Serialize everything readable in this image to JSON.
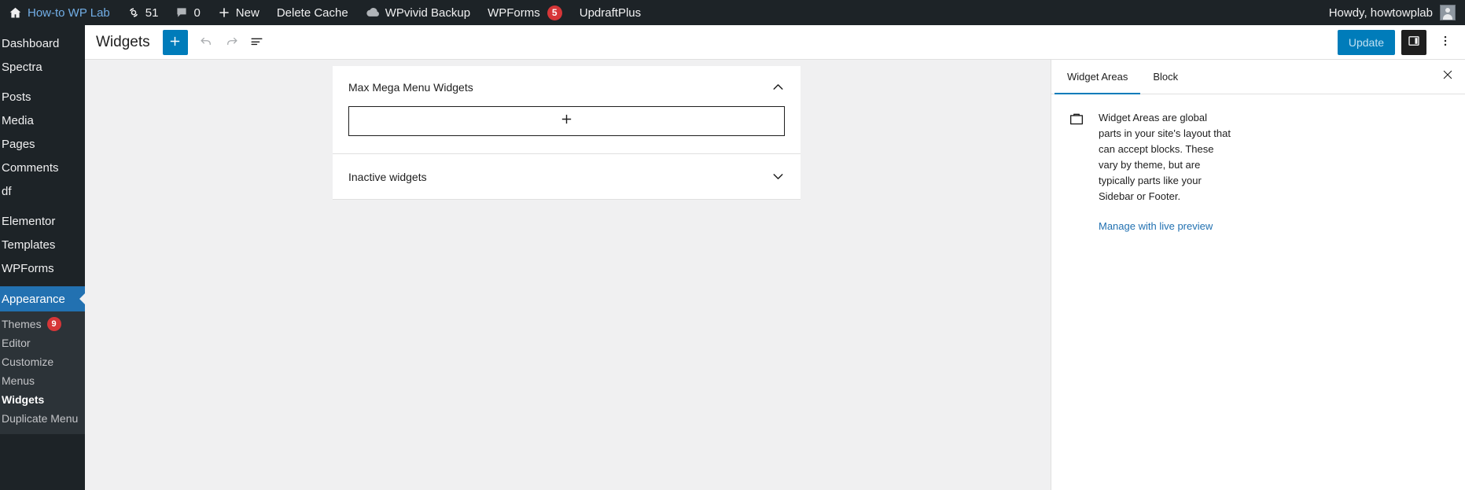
{
  "adminbar": {
    "site_name": "How-to WP Lab",
    "site_icon": "home-icon",
    "updates_icon": "updates-icon",
    "updates_count": "51",
    "comments_icon": "comment-bubble-icon",
    "comments_count": "0",
    "new_icon": "plus-icon",
    "new_label": "New",
    "delete_cache_label": "Delete Cache",
    "wpvivid_icon": "cloud-icon",
    "wpvivid_label": "WPvivid Backup",
    "wpforms_label": "WPForms",
    "wpforms_badge": "5",
    "updraftplus_label": "UpdraftPlus",
    "howdy_label": "Howdy, howtowplab",
    "avatar": "user-avatar"
  },
  "sidebar": {
    "items": [
      {
        "label": "Dashboard",
        "current": false
      },
      {
        "label": "Spectra",
        "current": false
      },
      {
        "label": "Posts",
        "current": false
      },
      {
        "label": "Media",
        "current": false
      },
      {
        "label": "Pages",
        "current": false
      },
      {
        "label": "Comments",
        "current": false
      },
      {
        "label": "df",
        "current": false
      },
      {
        "label": "Elementor",
        "current": false
      },
      {
        "label": "Templates",
        "current": false
      },
      {
        "label": "WPForms",
        "current": false
      },
      {
        "label": "Appearance",
        "current": true
      }
    ],
    "submenu": [
      {
        "label": "Themes",
        "badge": "9",
        "active": false
      },
      {
        "label": "Editor",
        "badge": "",
        "active": false
      },
      {
        "label": "Customize",
        "badge": "",
        "active": false
      },
      {
        "label": "Menus",
        "badge": "",
        "active": false
      },
      {
        "label": "Widgets",
        "badge": "",
        "active": true
      },
      {
        "label": "Duplicate Menu",
        "badge": "",
        "active": false
      }
    ]
  },
  "editor_header": {
    "title": "Widgets",
    "add_block_icon": "plus-icon",
    "undo_icon": "undo-arrow-icon",
    "redo_icon": "redo-arrow-icon",
    "list_view_icon": "list-view-icon",
    "update_label": "Update",
    "update_disabled": true,
    "settings_icon": "sidebar-panel-icon",
    "more_icon": "more-vertical-icon"
  },
  "canvas": {
    "widget_areas": [
      {
        "title": "Max Mega Menu Widgets",
        "expanded": true,
        "chevron_icon": "chevron-up-icon",
        "appender_icon": "plus-icon"
      },
      {
        "title": "Inactive widgets",
        "expanded": false,
        "chevron_icon": "chevron-down-icon",
        "appender_icon": ""
      }
    ]
  },
  "inspector": {
    "tabs": [
      {
        "label": "Widget Areas",
        "active": true
      },
      {
        "label": "Block",
        "active": false
      }
    ],
    "close_icon": "close-x-icon",
    "note_icon": "widget-area-icon",
    "note_text": "Widget Areas are global parts in your site's layout that can accept blocks. These vary by theme, but are typically parts like your Sidebar or Footer.",
    "preview_link": "Manage with live preview"
  },
  "colors": {
    "admin_dark": "#1d2327",
    "submenu_bg": "#2c3338",
    "accent_blue": "#2271b1",
    "wp_blue": "#007cba",
    "badge_red": "#d63638",
    "canvas_bg": "#f0f0f1"
  }
}
